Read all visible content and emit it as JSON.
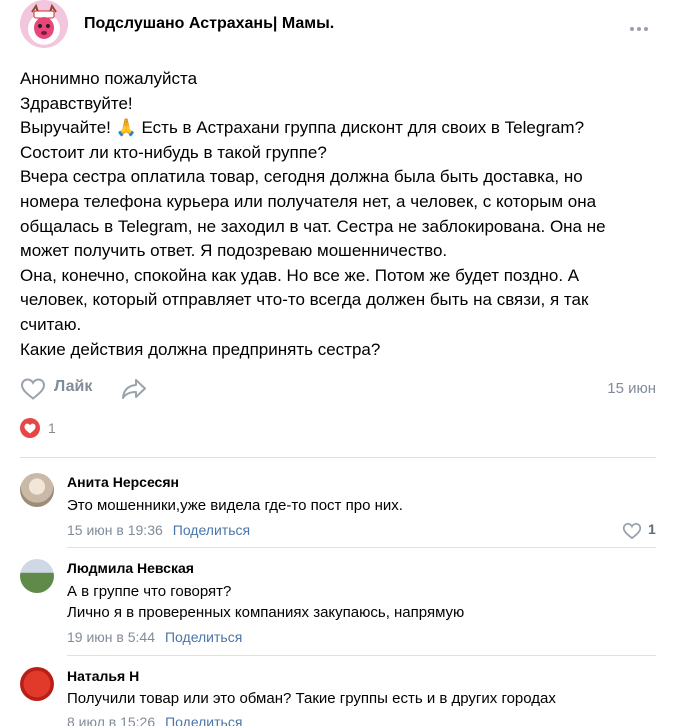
{
  "group": {
    "name": "Подслушано Астрахань| Мамы.",
    "avatar_icon": "deer-logo-icon"
  },
  "post": {
    "lines": [
      "Анонимно пожалуйста",
      "Здравствуйте!",
      "Выручайте! 🙏 Есть в Астрахани группа дисконт для своих в Telegram?",
      "Состоит ли кто-нибудь в такой группе?",
      "Вчера сестра оплатила товар, сегодня должна была быть доставка, но",
      "номера телефона курьера или получателя нет, а человек, с которым она",
      "общалась в Telegram, не заходил в чат. Сестра не заблокирована. Она не",
      "может получить ответ. Я подозреваю мошенничество.",
      "Она, конечно, спокойна как удав. Но все же. Потом же будет поздно. А",
      "человек, который отправляет что-то всегда должен быть на связи, я так",
      "считаю.",
      "Какие действия должна предпринять сестра?"
    ],
    "like_label": "Лайк",
    "date": "15 июн",
    "reactions_count": "1"
  },
  "comments": [
    {
      "author": "Анита Нерсесян",
      "lines": [
        "Это мошенники,уже видела где-то пост про них."
      ],
      "time": "15 июн в 19:36",
      "share_label": "Поделиться",
      "likes": "1"
    },
    {
      "author": "Людмила Невская",
      "lines": [
        "А в группе что говорят?",
        "Лично я в проверенных компаниях закупаюсь, напрямую"
      ],
      "time": "19 июн в 5:44",
      "share_label": "Поделиться"
    },
    {
      "author": "Наталья Н",
      "lines": [
        "Получили товар или это обман? Такие группы есть и в других городах"
      ],
      "time": "8 июл в 15:26",
      "share_label": "Поделиться"
    }
  ],
  "colors": {
    "secondary_text": "#818c99",
    "link": "#4a76a8",
    "reaction": "#e64646",
    "divider": "#dce1e6"
  }
}
